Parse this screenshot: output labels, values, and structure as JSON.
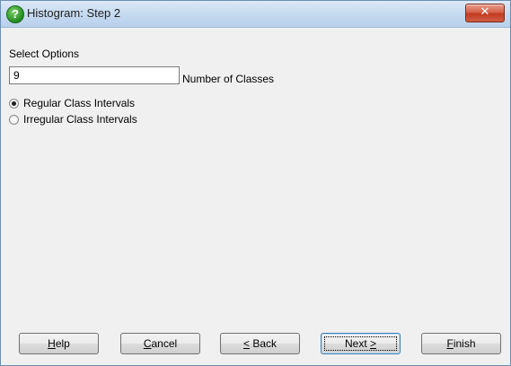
{
  "window": {
    "title": "Histogram: Step 2"
  },
  "icons": {
    "title_icon": "question-mark-icon",
    "close_icon": "close-x-icon"
  },
  "close_glyph": "✕",
  "title_glyph": "?",
  "main": {
    "select_options_label": "Select Options",
    "num_classes_value": "9",
    "num_classes_label": "Number of Classes",
    "radios": [
      {
        "label": "Regular Class Intervals",
        "selected": true
      },
      {
        "label": "Irregular Class Intervals",
        "selected": false
      }
    ]
  },
  "buttons": {
    "help": {
      "accel": "H",
      "rest": "elp"
    },
    "cancel": {
      "accel": "C",
      "rest": "ancel"
    },
    "back": {
      "accel": "<",
      "rest": " Back"
    },
    "next": {
      "pre": "Next ",
      "accel": ">"
    },
    "finish": {
      "accel": "F",
      "rest": "inish"
    }
  }
}
